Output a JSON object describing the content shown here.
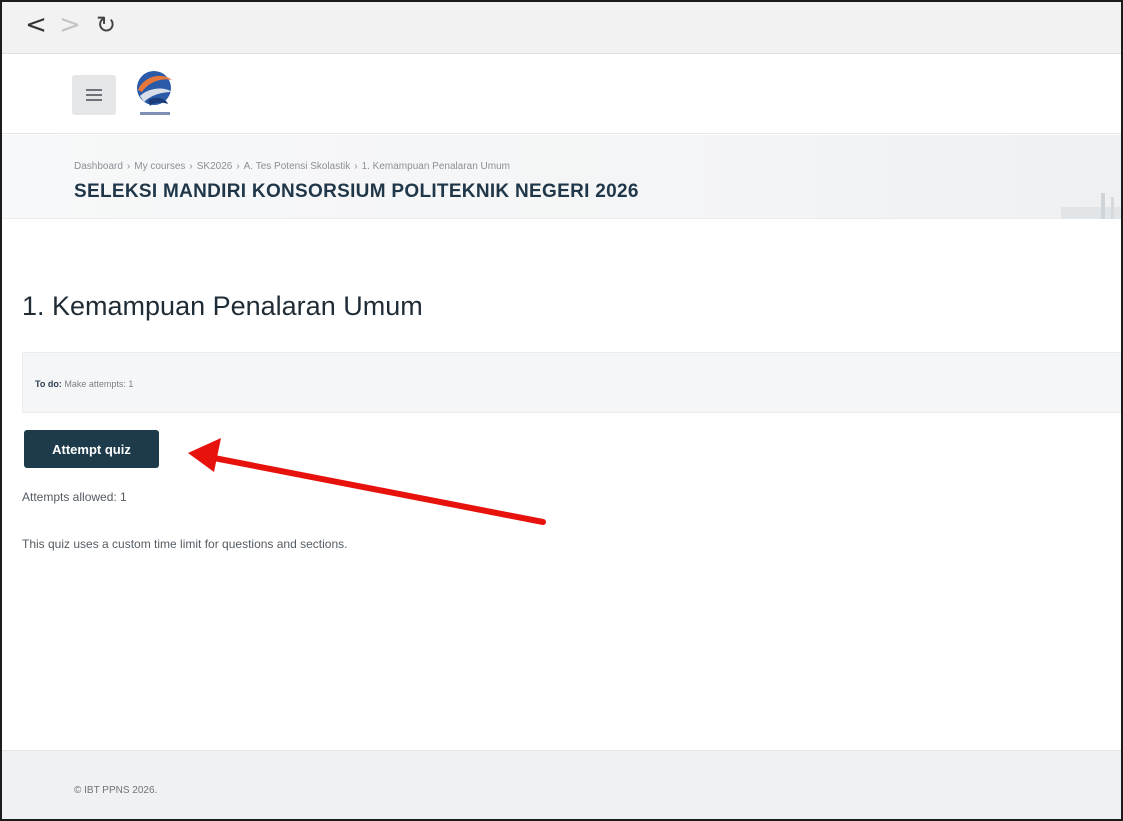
{
  "browser": {
    "back_icon": "chevron-left-icon",
    "forward_icon": "chevron-right-icon",
    "reload_icon": "reload-icon",
    "back_glyph": "<",
    "forward_glyph": ">",
    "reload_glyph": "↻"
  },
  "header": {
    "menu_icon": "hamburger-menu-icon",
    "logo_icon": "ppns-logo-icon"
  },
  "breadcrumb": {
    "items": [
      "Dashboard",
      "My courses",
      "SK2026",
      "A. Tes Potensi Skolastik",
      "1. Kemampuan Penalaran Umum"
    ],
    "separator": "›"
  },
  "site_title": "SELEKSI MANDIRI KONSORSIUM POLITEKNIK NEGERI 2026",
  "main": {
    "page_title": "1. Kemampuan Penalaran Umum",
    "todo_label": "To do:",
    "todo_value": "Make attempts: 1",
    "attempt_button": "Attempt quiz",
    "attempts_allowed": "Attempts allowed: 1",
    "time_limit_note": "This quiz uses a custom time limit for questions and sections."
  },
  "annotation": {
    "arrow_color": "#e8120c"
  },
  "footer": {
    "copyright": "© IBT PPNS 2026."
  },
  "colors": {
    "primary": "#1d3b4b",
    "title": "#1f3748"
  }
}
